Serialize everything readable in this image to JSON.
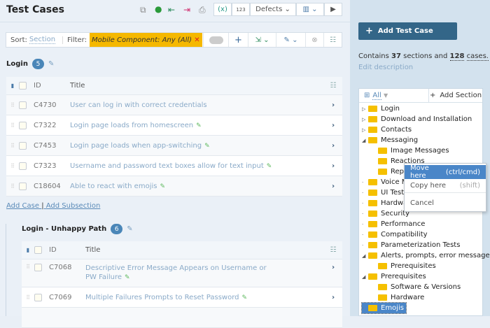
{
  "header": {
    "title": "Test Cases",
    "defects_label": "Defects"
  },
  "filter": {
    "sort_label": "Sort:",
    "sort_value": "Section",
    "filter_label": "Filter:",
    "filter_chip": "Mobile Component: Any (All)"
  },
  "sections": [
    {
      "name": "Login",
      "count": "5",
      "columns": {
        "id": "ID",
        "title": "Title"
      },
      "rows": [
        {
          "id": "C4730",
          "title": "User can log in with correct credentials",
          "edited": false
        },
        {
          "id": "C7322",
          "title": "Login page loads from homescreen",
          "edited": true
        },
        {
          "id": "C7453",
          "title": "Login page loads when app-switching",
          "edited": true
        },
        {
          "id": "C7323",
          "title": "Username and password text boxes allow for text input",
          "edited": true
        },
        {
          "id": "C18604",
          "title": "Able to react with emojis",
          "edited": true
        }
      ]
    },
    {
      "name": "Login - Unhappy Path",
      "count": "6",
      "columns": {
        "id": "ID",
        "title": "Title"
      },
      "rows": [
        {
          "id": "C7068",
          "title": "Descriptive Error Message Appears on Username or PW Failure",
          "edited": true
        },
        {
          "id": "C7069",
          "title": "Multiple Failures Prompts to Reset Password",
          "edited": true
        }
      ]
    }
  ],
  "links": {
    "add_case": "Add Case",
    "sep": "|",
    "add_subsection": "Add Subsection"
  },
  "sidebar": {
    "add_test_case": "Add Test Case",
    "contains_pre": "Contains",
    "sections": "37",
    "contains_mid": "sections and",
    "cases": "128",
    "contains_post": "cases.",
    "edit_description": "Edit description",
    "tree_filter": "All",
    "add_section": "Add Section",
    "tree": [
      {
        "label": "Login",
        "level": 0,
        "toggle": "collapsed"
      },
      {
        "label": "Download and Installation",
        "level": 0,
        "toggle": "collapsed"
      },
      {
        "label": "Contacts",
        "level": 0,
        "toggle": "collapsed"
      },
      {
        "label": "Messaging",
        "level": 0,
        "toggle": "expanded"
      },
      {
        "label": "Image Messages",
        "level": 1
      },
      {
        "label": "Reactions",
        "level": 1
      },
      {
        "label": "Replies",
        "level": 1
      },
      {
        "label": "Voice Messages",
        "level": 0
      },
      {
        "label": "UI Tests",
        "level": 0
      },
      {
        "label": "Hardware",
        "level": 0
      },
      {
        "label": "Security",
        "level": 0
      },
      {
        "label": "Performance",
        "level": 0
      },
      {
        "label": "Compatibility",
        "level": 0
      },
      {
        "label": "Parameterization Tests",
        "level": 0
      },
      {
        "label": "Alerts, prompts, error messages",
        "level": 0,
        "toggle": "expanded"
      },
      {
        "label": "Prerequisites",
        "level": 1
      },
      {
        "label": "Prerequisites",
        "level": 0,
        "toggle": "expanded"
      },
      {
        "label": "Software & Versions",
        "level": 1
      },
      {
        "label": "Hardware",
        "level": 1
      },
      {
        "label": "Emojis",
        "level": 0,
        "selected": true
      }
    ]
  },
  "context_menu": [
    {
      "label": "Move here",
      "shortcut": "(ctrl/cmd)",
      "active": true
    },
    {
      "label": "Copy here",
      "shortcut": "(shift)"
    },
    {
      "label": "Cancel",
      "shortcut": ""
    }
  ],
  "colors": {
    "accent": "#336688",
    "chip": "#f5b800",
    "folder": "#f5c000",
    "selected": "#4a86c8"
  }
}
